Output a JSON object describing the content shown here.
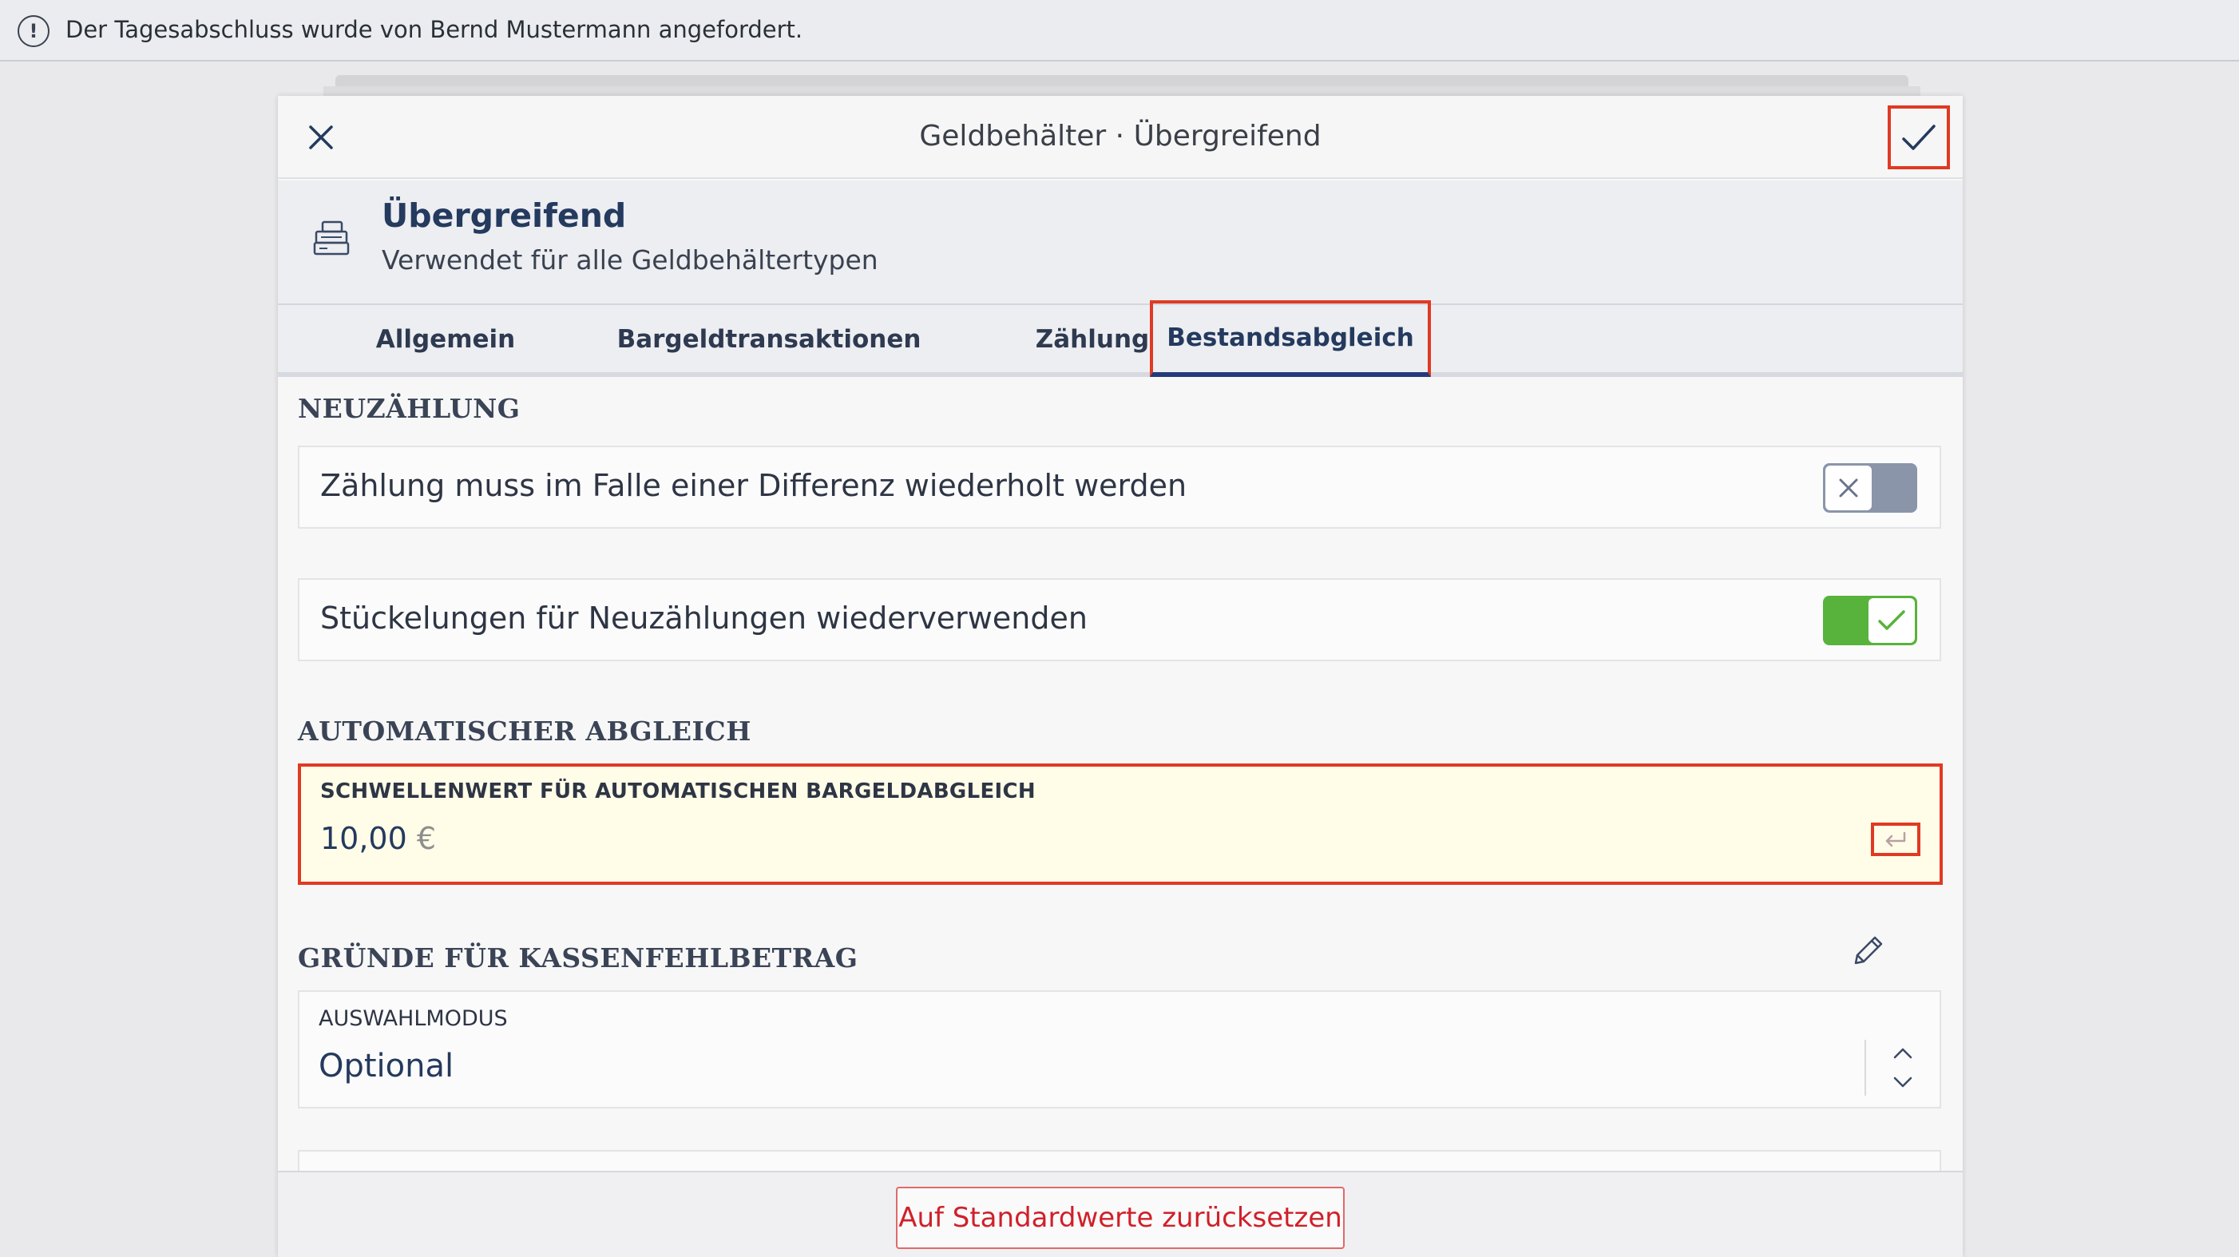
{
  "notification": {
    "icon": "exclamation-circle-icon",
    "text": "Der Tagesabschluss wurde von Bernd Mustermann angefordert."
  },
  "header": {
    "title": "Geldbehälter · Übergreifend",
    "close_icon": "close-icon",
    "confirm_icon": "checkmark-icon"
  },
  "subheader": {
    "icon": "cash-register-icon",
    "title": "Übergreifend",
    "description": "Verwendet für alle Geldbehältertypen"
  },
  "tabs": [
    {
      "label": "Allgemein",
      "active": false
    },
    {
      "label": "Bargeldtransaktionen",
      "active": false
    },
    {
      "label": "Zählung",
      "active": false
    },
    {
      "label": "Bestandsabgleich",
      "active": true
    }
  ],
  "sections": {
    "recount": {
      "title": "NEUZÄHLUNG",
      "items": [
        {
          "label": "Zählung muss im Falle einer Differenz wiederholt werden",
          "enabled": false
        },
        {
          "label": "Stückelungen für Neuzählungen wiederverwenden",
          "enabled": true
        }
      ]
    },
    "auto_reconcile": {
      "title": "AUTOMATISCHER ABGLEICH",
      "field_label": "SCHWELLENWERT FÜR AUTOMATISCHEN BARGELDABGLEICH",
      "value": "10,00",
      "unit": "€"
    },
    "shortage_reasons": {
      "title": "GRÜNDE FÜR KASSENFEHLBETRAG",
      "select_label": "AUSWAHLMODUS",
      "select_value": "Optional"
    }
  },
  "footer": {
    "reset_label": "Auf Standardwerte zurücksetzen"
  },
  "colors": {
    "highlight": "#e03a22",
    "toggle_on": "#58b33c",
    "toggle_off": "#8a95aa",
    "brand_text": "#243a5e"
  }
}
